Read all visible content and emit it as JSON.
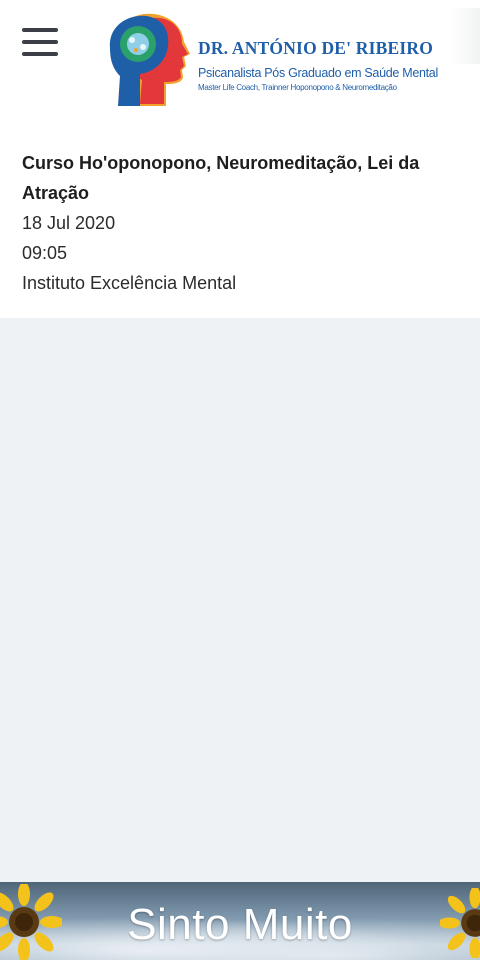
{
  "header": {
    "menu_icon": "hamburger-menu-icon",
    "logo": {
      "name": "DR. ANTÓNIO DE' RIBEIRO",
      "line1": "Psicanalista Pós Graduado em Saúde Mental",
      "line2": "Master Life Coach, Trainner Hoponopono & Neuromeditação"
    }
  },
  "event": {
    "title": "Curso Ho'oponopono, Neuromeditação, Lei da Atração",
    "date": "18 Jul 2020",
    "time": "09:05",
    "organizer": "Instituto Excelência Mental"
  },
  "banner": {
    "text": "Sinto Muito"
  },
  "colors": {
    "brand_blue": "#1f5fa8",
    "page_background": "#eef2f5",
    "card_background": "#ffffff"
  }
}
